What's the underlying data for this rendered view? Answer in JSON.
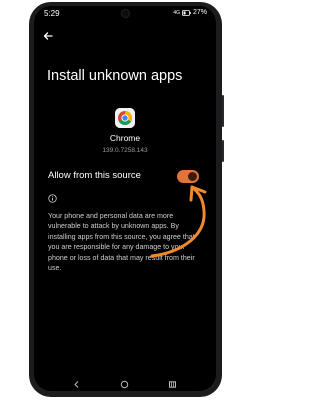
{
  "status_bar": {
    "time": "5:29",
    "network": "4G",
    "battery": "27%"
  },
  "page_title": "Install unknown apps",
  "app": {
    "name": "Chrome",
    "version": "139.0.7258.143"
  },
  "setting": {
    "label": "Allow from this source",
    "enabled": true
  },
  "info_text": "Your phone and personal data are more vulnerable to attack by unknown apps. By installing apps from this source, you agree that you are responsible for any damage to your phone or loss of data that may result from their use.",
  "colors": {
    "accent": "#e0743b",
    "annotation_arrow": "#f08a2c",
    "background": "#000000"
  },
  "icons": [
    "back-arrow-icon",
    "chrome-icon",
    "info-icon",
    "battery-icon",
    "nav-back-icon",
    "nav-home-icon",
    "nav-recents-icon"
  ]
}
